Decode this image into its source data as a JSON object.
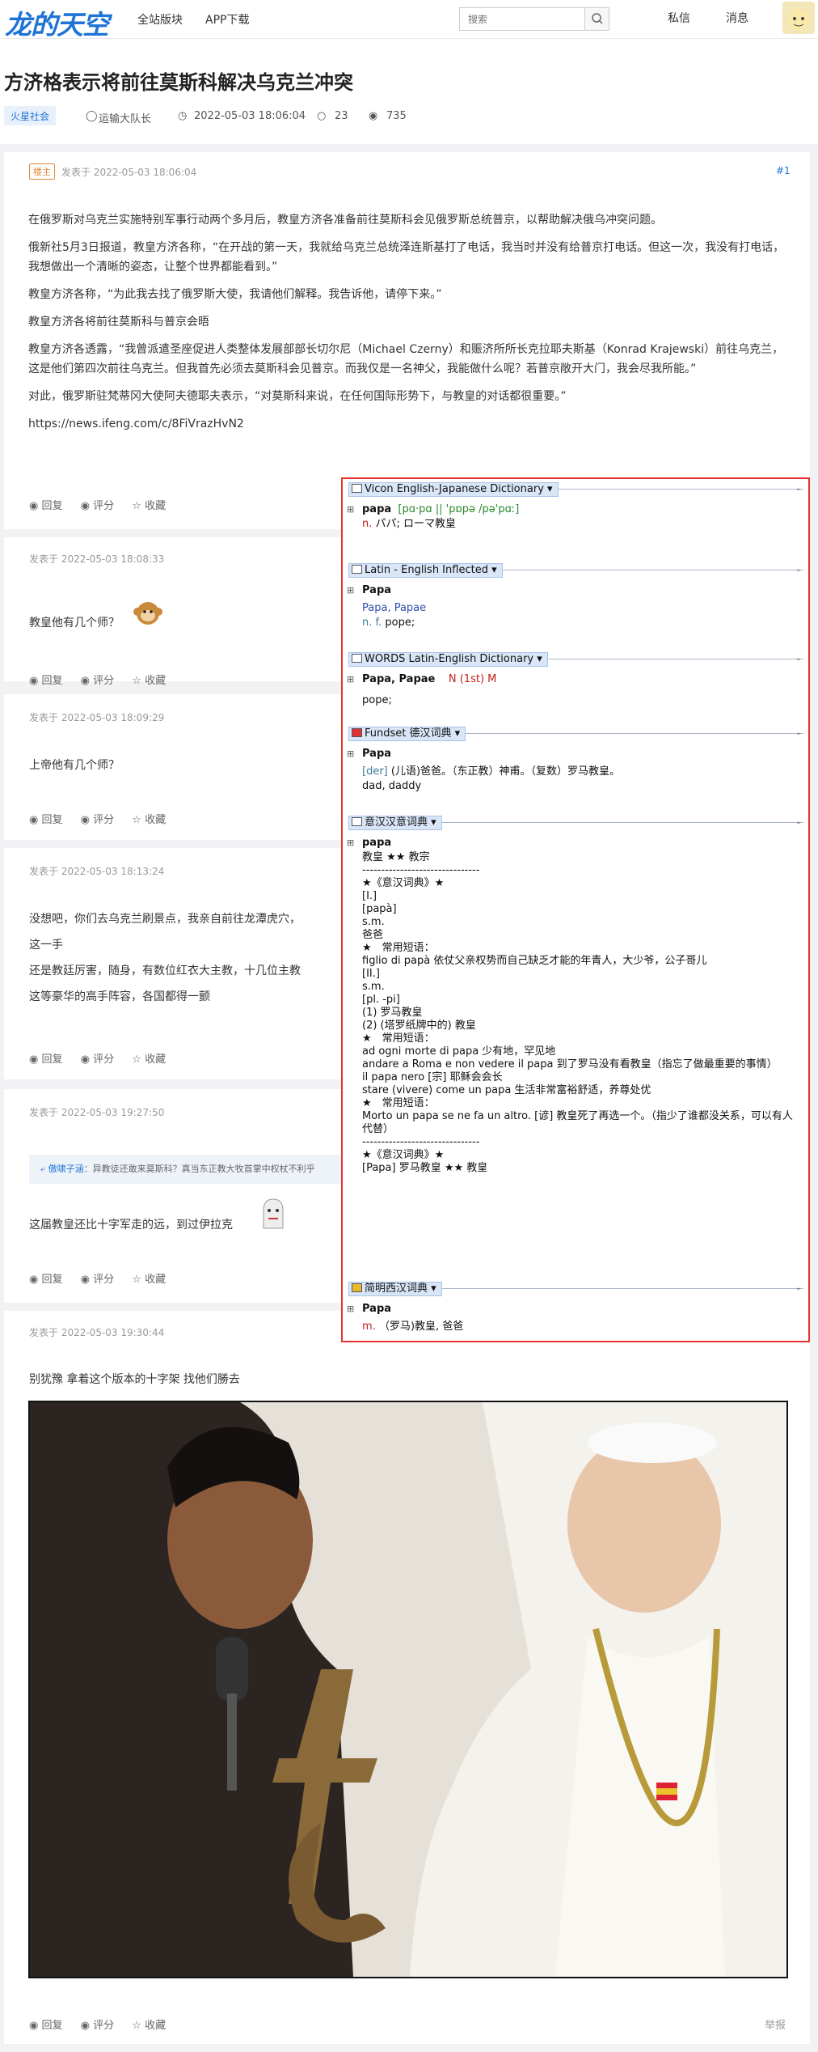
{
  "header": {
    "logo": "龙的天空",
    "nav": [
      "全站版块",
      "APP下载"
    ],
    "search_placeholder": "搜索",
    "private_msg": "私信",
    "messages": "消息"
  },
  "thread": {
    "title": "方济格表示将前往莫斯科解决乌克兰冲突",
    "tag": "火星社会",
    "author": "运输大队长",
    "date": "2022-05-03 18:06:04",
    "comments": "23",
    "views": "735"
  },
  "post1": {
    "badge": "楼主",
    "time": "发表于 2022-05-03 18:06:04",
    "floor": "#1",
    "paras": [
      "在俄罗斯对乌克兰实施特别军事行动两个多月后，教皇方济各准备前往莫斯科会见俄罗斯总统普京，以帮助解决俄乌冲突问题。",
      "俄新社5月3日报道，教皇方济各称，“在开战的第一天，我就给乌克兰总统泽连斯基打了电话，我当时并没有给普京打电话。但这一次，我没有打电话，我想做出一个清晰的姿态，让整个世界都能看到。”",
      "教皇方济各称，“为此我去找了俄罗斯大使，我请他们解释。我告诉他，请停下来。”",
      "教皇方济各将前往莫斯科与普京会晤",
      "教皇方济各透露，“我曾派遣圣座促进人类整体发展部部长切尔尼（Michael Czerny）和赈济所所长克拉耶夫斯基（Konrad Krajewski）前往乌克兰，这是他们第四次前往乌克兰。但我首先必须去莫斯科会见普京。而我仅是一名神父，我能做什么呢？若普京敞开大门，我会尽我所能。”",
      "对此，俄罗斯驻梵蒂冈大使阿夫德耶夫表示，“对莫斯科来说，在任何国际形势下，与教皇的对话都很重要。”"
    ],
    "link": "https://news.ifeng.com/c/8FiVrazHvN2"
  },
  "actions": {
    "reply": "回复",
    "rate": "评分",
    "fav": "收藏",
    "report": "举报"
  },
  "post2": {
    "time": "发表于 2022-05-03 18:08:33",
    "text": "教皇他有几个师？"
  },
  "post3": {
    "time": "发表于 2022-05-03 18:09:29",
    "text": "上帝他有几个师？"
  },
  "post4": {
    "time": "发表于 2022-05-03 18:13:24",
    "lines": [
      "没想吧，你们去乌克兰刷景点，我亲自前往龙潭虎穴，",
      "这一手",
      "还是教廷厉害，随身，有数位红衣大主教，十几位主教",
      "这等豪华的高手阵容，各国都得一颤"
    ]
  },
  "post5": {
    "time": "发表于 2022-05-03 19:27:50",
    "quote_user": "傲啸子涵",
    "quote_text": "：异教徒还敢来莫斯科？真当东正教大牧首掌中权杖不利乎",
    "text": "这届教皇还比十字军走的远，到过伊拉克"
  },
  "post6": {
    "time": "发表于 2022-05-03 19:30:44",
    "text": "别犹豫 拿着这个版本的十字架 找他们勝去"
  },
  "dict": {
    "vicon": {
      "header": "Vicon English-Japanese Dictionary",
      "word": "papa",
      "pron": "[pɑ·pɑ || 'pɒpə /pə'pɑː]",
      "pos": "n.",
      "def": "パパ; ローマ教皇"
    },
    "latin": {
      "header": "Latin - English Inflected",
      "word": "Papa",
      "forms": "Papa, Papae",
      "pos": "n. f.",
      "def": "pope;"
    },
    "words": {
      "header": "WORDS Latin-English Dictionary",
      "word": "Papa, Papae",
      "gram": "N (1st) M",
      "def": "pope;"
    },
    "fundset": {
      "header": "Fundset 德汉词典",
      "word": "Papa",
      "tag": "[der]",
      "def": "(儿语)爸爸。（东正教）神甫。（复数）罗马教皇。",
      "def2": "dad, daddy"
    },
    "yihan": {
      "header": "意汉汉意词典",
      "word": "papa",
      "lines": [
        "教皇 ★★ 教宗",
        "-------------------------------",
        "★《意汉词典》★",
        "[I.]",
        "[papà]",
        "s.m.",
        "爸爸",
        "★　常用短语：",
        "figlio di papà 依仗父亲权势而自己缺乏才能的年青人，大少爷，公子哥儿",
        "[II.]",
        "s.m.",
        "[pl. -pi]",
        "(1) 罗马教皇",
        "(2) (塔罗纸牌中的) 教皇",
        "★　常用短语：",
        "ad ogni morte di papa 少有地，罕见地",
        "andare a Roma e non vedere il papa 到了罗马没有看教皇（指忘了做最重要的事情）",
        "il papa nero [宗] 耶稣会会长",
        "stare (vivere) come un papa 生活非常富裕舒适，养尊处优",
        "★　常用短语：",
        "Morto un papa se ne fa un altro. [谚] 教皇死了再选一个。（指少了谁都没关系，可以有人代替）",
        "-------------------------------",
        "★《意汉词典》★",
        "[Papa] 罗马教皇 ★★ 教皇"
      ]
    },
    "jianming": {
      "header": "简明西汉词典",
      "word": "Papa",
      "pos": "m.",
      "def": "（罗马)教皇, 爸爸"
    }
  },
  "colors": {
    "accent": "#1e74d6",
    "popup_border": "#e8342f"
  }
}
